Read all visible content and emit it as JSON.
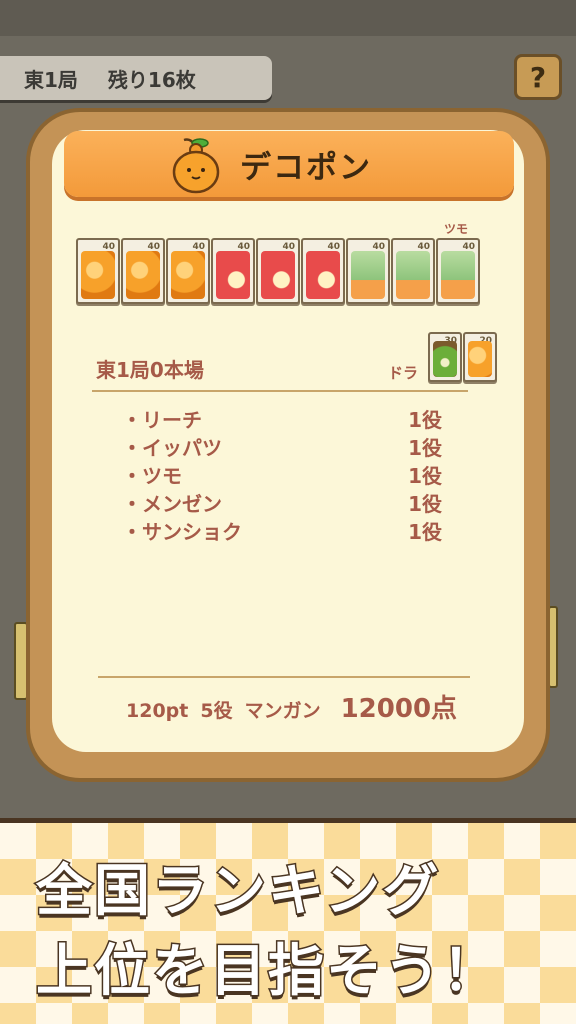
{
  "header": {
    "round": "東1局",
    "remaining": "残り16枚",
    "help_label": "?"
  },
  "dialog": {
    "title": "デコポン",
    "tsumo_mark": "ツモ",
    "hand_tiles": [
      {
        "fruit": "orange",
        "num": "40"
      },
      {
        "fruit": "orange",
        "num": "40"
      },
      {
        "fruit": "orange",
        "num": "40"
      },
      {
        "fruit": "apple",
        "num": "40"
      },
      {
        "fruit": "apple",
        "num": "40"
      },
      {
        "fruit": "apple",
        "num": "40"
      },
      {
        "fruit": "melon",
        "num": "40"
      },
      {
        "fruit": "melon",
        "num": "40"
      },
      {
        "fruit": "melon",
        "num": "40"
      }
    ],
    "round_info": "東1局0本場",
    "dora_label": "ドラ",
    "dora_tiles": [
      {
        "fruit": "kiwi",
        "num": "30"
      },
      {
        "fruit": "orange",
        "num": "20"
      }
    ],
    "yaku": [
      {
        "name": "リーチ",
        "han": "1役"
      },
      {
        "name": "イッパツ",
        "han": "1役"
      },
      {
        "name": "ツモ",
        "han": "1役"
      },
      {
        "name": "メンゼン",
        "han": "1役"
      },
      {
        "name": "サンショク",
        "han": "1役"
      }
    ],
    "score": {
      "points": "120pt",
      "yaku_count": "5役",
      "hand_name": "マンガン",
      "total": "12000点"
    }
  },
  "promo": {
    "line1": "全国ランキング",
    "line2": "上位を目指そう！"
  },
  "colors": {
    "accent_orange": "#f39a3a",
    "text_brown": "#a65a48",
    "panel_cream": "#fcf7d8"
  }
}
